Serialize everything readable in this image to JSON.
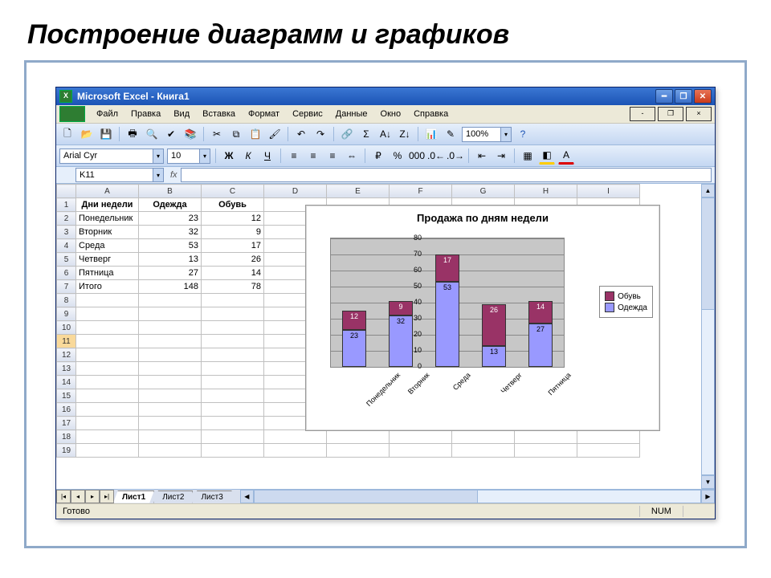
{
  "slide": {
    "title": "Построение диаграмм и графиков"
  },
  "window": {
    "title": "Microsoft Excel - Книга1"
  },
  "menu": {
    "items": [
      "Файл",
      "Правка",
      "Вид",
      "Вставка",
      "Формат",
      "Сервис",
      "Данные",
      "Окно",
      "Справка"
    ]
  },
  "toolbar": {
    "zoom": "100%"
  },
  "format": {
    "font": "Arial Cyr",
    "size": "10"
  },
  "namebox": {
    "cell": "K11"
  },
  "columns": [
    "A",
    "B",
    "C",
    "D",
    "E",
    "F",
    "G",
    "H",
    "I"
  ],
  "rows_visible": 19,
  "selected_row": 11,
  "table": {
    "headers": [
      "Дни недели",
      "Одежда",
      "Обувь"
    ],
    "rows": [
      {
        "a": "Понедельник",
        "b": "23",
        "c": "12"
      },
      {
        "a": "Вторник",
        "b": "32",
        "c": "9"
      },
      {
        "a": "Среда",
        "b": "53",
        "c": "17"
      },
      {
        "a": "Четверг",
        "b": "13",
        "c": "26"
      },
      {
        "a": "Пятница",
        "b": "27",
        "c": "14"
      },
      {
        "a": "Итого",
        "b": "148",
        "c": "78"
      }
    ]
  },
  "chart_data": {
    "type": "bar",
    "title": "Продажа по дням недели",
    "categories": [
      "Понедельник",
      "Вторник",
      "Среда",
      "Четверг",
      "Пятница"
    ],
    "series": [
      {
        "name": "Одежда",
        "values": [
          23,
          32,
          53,
          13,
          27
        ],
        "color": "#9999ff"
      },
      {
        "name": "Обувь",
        "values": [
          12,
          9,
          17,
          26,
          14
        ],
        "color": "#993366"
      }
    ],
    "ylim": [
      0,
      80
    ],
    "yticks": [
      0,
      10,
      20,
      30,
      40,
      50,
      60,
      70,
      80
    ],
    "legend_order": [
      "Обувь",
      "Одежда"
    ],
    "stacked": true
  },
  "sheets": {
    "active": "Лист1",
    "others": [
      "Лист2",
      "Лист3"
    ]
  },
  "status": {
    "ready": "Готово",
    "num": "NUM"
  }
}
